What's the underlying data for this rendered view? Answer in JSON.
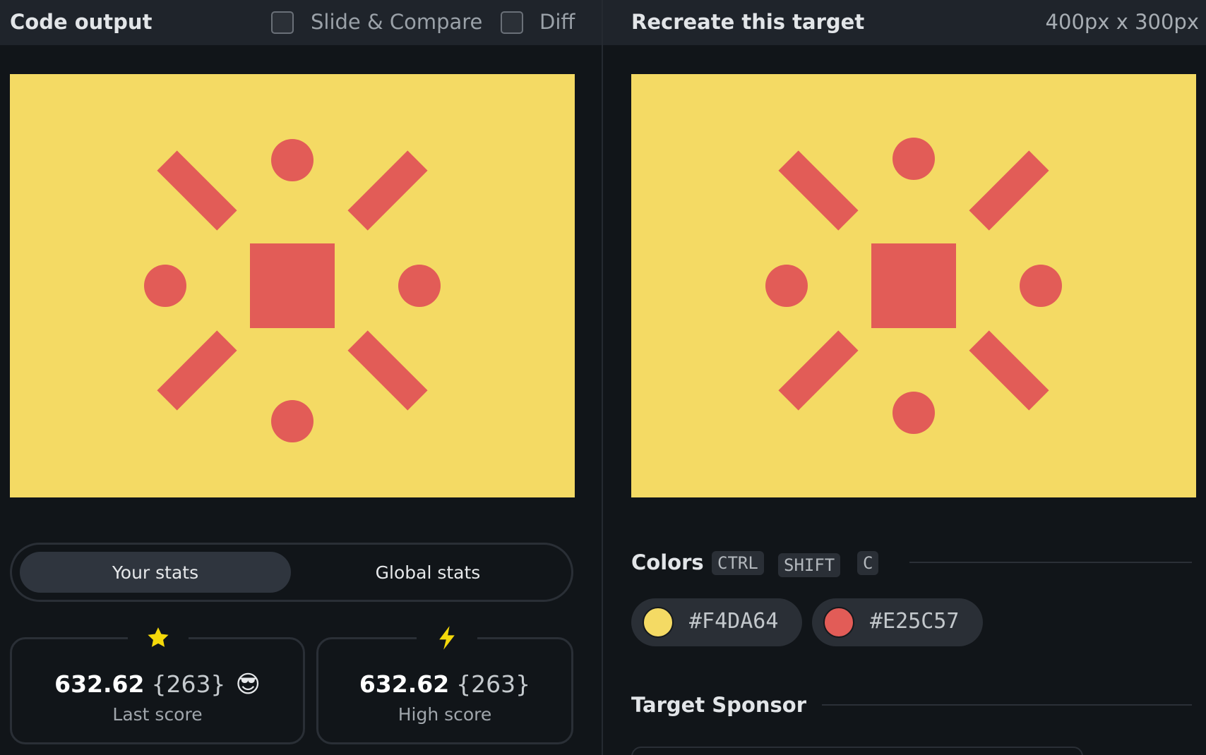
{
  "left_panel": {
    "title": "Code output",
    "slide_compare_label": "Slide & Compare",
    "diff_label": "Diff"
  },
  "right_panel": {
    "title": "Recreate this target",
    "dimensions": "400px x 300px"
  },
  "colors": {
    "background": "#F4DA64",
    "shape": "#E25C57"
  },
  "target_shapes": {
    "canvas": "400x300",
    "center_square": "120x120",
    "circles": 4,
    "bars": 4
  },
  "stats": {
    "tabs": [
      {
        "label": "Your stats",
        "active": true
      },
      {
        "label": "Global stats",
        "active": false
      }
    ],
    "last": {
      "icon": "star-icon",
      "value": "632.62",
      "count": "{263}",
      "emoji": "😎",
      "label": "Last score"
    },
    "high": {
      "icon": "lightning-icon",
      "value": "632.62",
      "count": "{263}",
      "label": "High score"
    }
  },
  "colors_section": {
    "title": "Colors",
    "shortcut": [
      "CTRL",
      "SHIFT",
      "C"
    ],
    "swatches": [
      {
        "hex": "#F4DA64"
      },
      {
        "hex": "#E25C57"
      }
    ]
  },
  "sponsor_section": {
    "title": "Target Sponsor"
  }
}
